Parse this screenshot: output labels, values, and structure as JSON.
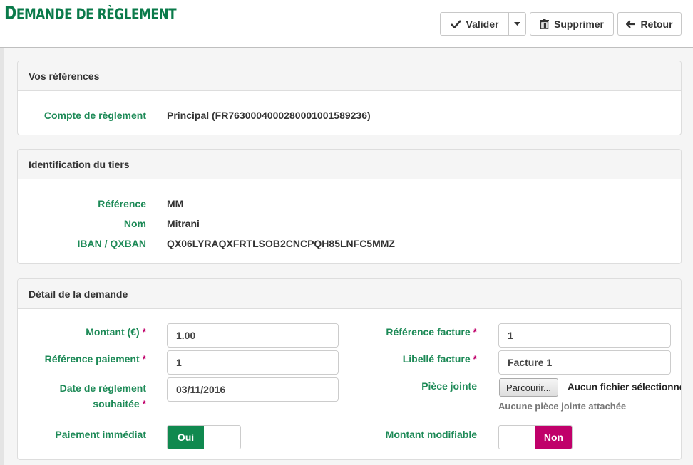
{
  "header": {
    "title_big": "D",
    "title_rest": "EMANDE DE RÈGLEMENT",
    "title_full": "Demande de règlement"
  },
  "toolbar": {
    "validate_label": "Valider",
    "delete_label": "Supprimer",
    "back_label": "Retour"
  },
  "references": {
    "heading": "Vos références",
    "account_label": "Compte de règlement",
    "account_value": "Principal (FR7630004000280001001589236)"
  },
  "third_party": {
    "heading": "Identification du tiers",
    "reference_label": "Référence",
    "reference_value": "MM",
    "name_label": "Nom",
    "name_value": "Mitrani",
    "iban_label": "IBAN / QXBAN",
    "iban_value": "QX06LYRAQXFRTLSOB2CNCPQH85LNFC5MMZ"
  },
  "request": {
    "heading": "Détail de la demande",
    "amount_label": "Montant (€)",
    "amount_value": "1.00",
    "payment_ref_label": "Référence paiement",
    "payment_ref_value": "1",
    "date_label_line1": "Date de règlement",
    "date_label_line2": "souhaitée",
    "date_value": "03/11/2016",
    "immediate_label": "Paiement immédiat",
    "immediate_on_label": "Oui",
    "invoice_ref_label": "Référence facture",
    "invoice_ref_value": "1",
    "invoice_title_label": "Libellé facture",
    "invoice_title_value": "Facture 1",
    "attachment_label": "Pièce jointe",
    "browse_label": "Parcourir...",
    "no_file_text": "Aucun fichier sélectionné.",
    "no_attachment_text": "Aucune pièce jointe attachée",
    "editable_amount_label": "Montant modifiable",
    "editable_amount_off_label": "Non",
    "required_mark": "*"
  },
  "colors": {
    "brand_green": "#0a7a4a",
    "label_green": "#1d8a57",
    "toggle_on": "#10894f",
    "toggle_off": "#c0006a"
  }
}
